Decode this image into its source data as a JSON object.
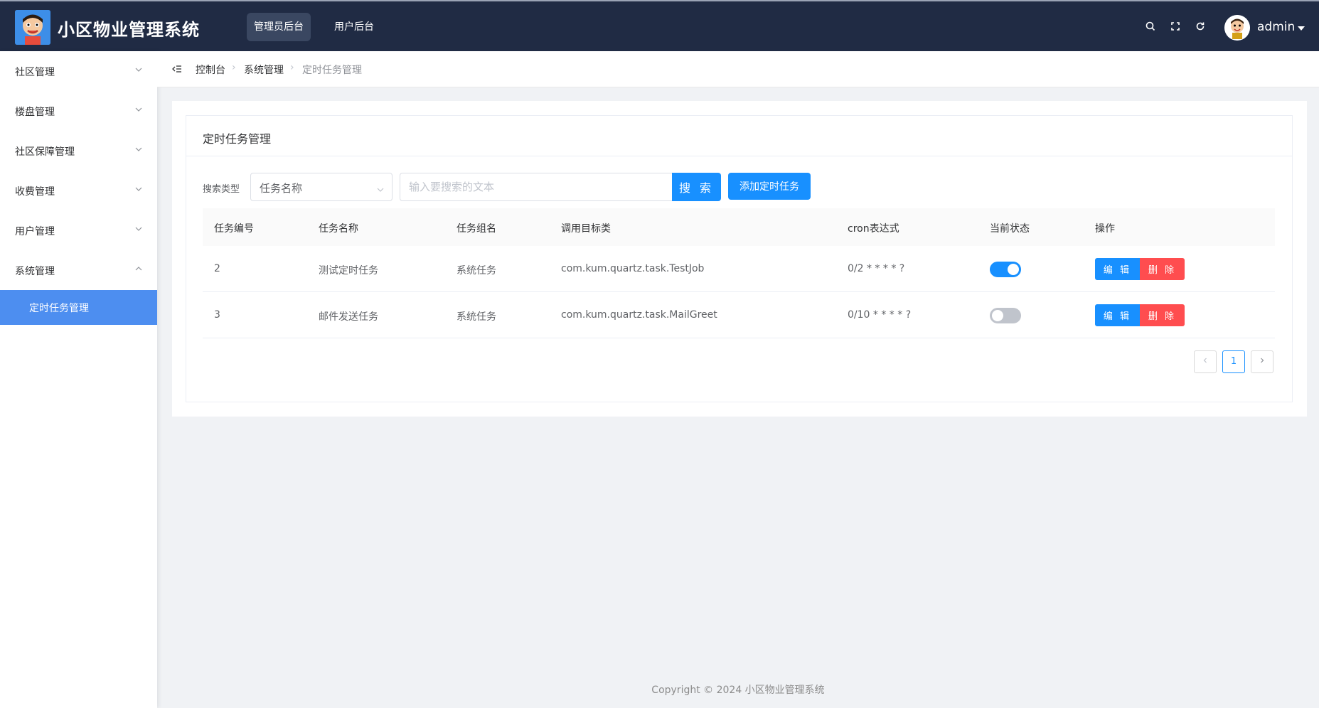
{
  "header": {
    "app_title": "小区物业管理系统",
    "tabs": [
      {
        "label": "管理员后台",
        "active": true
      },
      {
        "label": "用户后台",
        "active": false
      }
    ],
    "icons": [
      "search-icon",
      "fullscreen-icon",
      "refresh-icon"
    ],
    "user": {
      "name": "admin"
    },
    "bg_color": "#202b44"
  },
  "sidebar": {
    "items": [
      {
        "label": "社区管理",
        "expanded": false
      },
      {
        "label": "楼盘管理",
        "expanded": false
      },
      {
        "label": "社区保障管理",
        "expanded": false
      },
      {
        "label": "收费管理",
        "expanded": false
      },
      {
        "label": "用户管理",
        "expanded": false
      },
      {
        "label": "系统管理",
        "expanded": true
      }
    ],
    "active_sub": {
      "label": "定时任务管理"
    },
    "accent_color": "#4d8ef0"
  },
  "breadcrumb": [
    "控制台",
    "系统管理",
    "定时任务管理"
  ],
  "card": {
    "title": "定时任务管理",
    "search": {
      "label": "搜索类型",
      "select_value": "任务名称",
      "placeholder": "输入要搜索的文本",
      "button_label": "搜 索"
    },
    "add_button_label": "添加定时任务"
  },
  "table": {
    "columns": [
      "任务编号",
      "任务名称",
      "任务组名",
      "调用目标类",
      "cron表达式",
      "当前状态",
      "操作"
    ],
    "rows": [
      {
        "id": "2",
        "name": "测试定时任务",
        "group": "系统任务",
        "target": "com.kum.quartz.task.TestJob",
        "cron": "0/2 * * * * ?",
        "status_on": true
      },
      {
        "id": "3",
        "name": "邮件发送任务",
        "group": "系统任务",
        "target": "com.kum.quartz.task.MailGreet",
        "cron": "0/10 * * * * ?",
        "status_on": false
      }
    ],
    "edit_label": "编 辑",
    "delete_label": "删 除"
  },
  "pagination": {
    "current": "1"
  },
  "footer": {
    "text": "Copyright © 2024 小区物业管理系统"
  },
  "colors": {
    "primary": "#1890ff",
    "danger": "#ff4d4f"
  }
}
